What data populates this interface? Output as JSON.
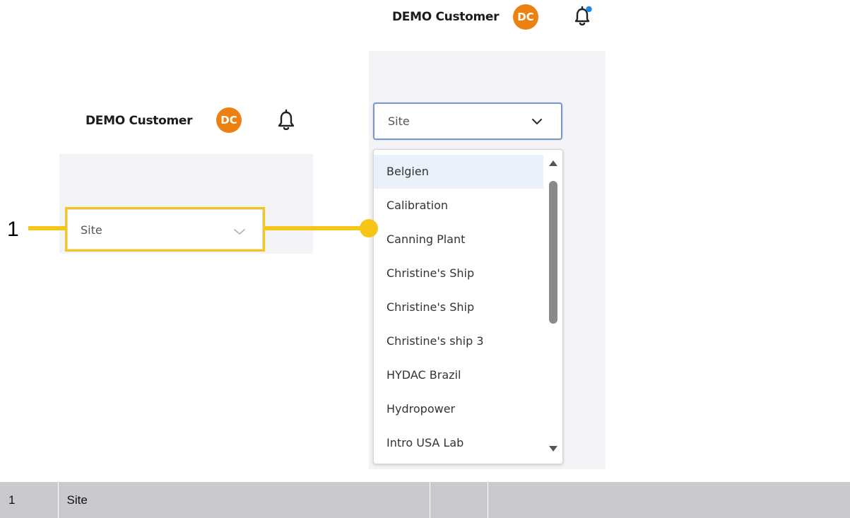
{
  "header_top": {
    "user_name": "DEMO Customer",
    "avatar_initials": "DC",
    "notification_icon": "bell-icon",
    "has_notification_dot": true
  },
  "header_left": {
    "user_name": "DEMO Customer",
    "avatar_initials": "DC",
    "notification_icon": "bell-icon"
  },
  "left_select": {
    "placeholder": "Site",
    "icon": "chevron-down-icon"
  },
  "right_select": {
    "placeholder": "Site",
    "icon": "chevron-down-icon"
  },
  "dropdown": {
    "options": [
      "Belgien",
      "Calibration",
      "Canning Plant",
      "Christine's Ship",
      "Christine's Ship",
      "Christine's ship 3",
      "HYDAC Brazil",
      "Hydropower",
      "Intro USA Lab"
    ],
    "highlighted_index": 0,
    "scroll_up_icon": "triangle-up-icon",
    "scroll_down_icon": "triangle-down-icon"
  },
  "callout": {
    "number": "1"
  },
  "legend": {
    "rows": [
      {
        "number": "1",
        "label": "Site",
        "col3": "",
        "col4": ""
      }
    ]
  },
  "colors": {
    "avatar": "#ec8010",
    "notification_dot": "#1e88e5",
    "callout": "#f5c518",
    "panel": "#f3f4f8",
    "legend_bg": "#c8cacd",
    "select_focus_border": "#7a9ac4"
  }
}
